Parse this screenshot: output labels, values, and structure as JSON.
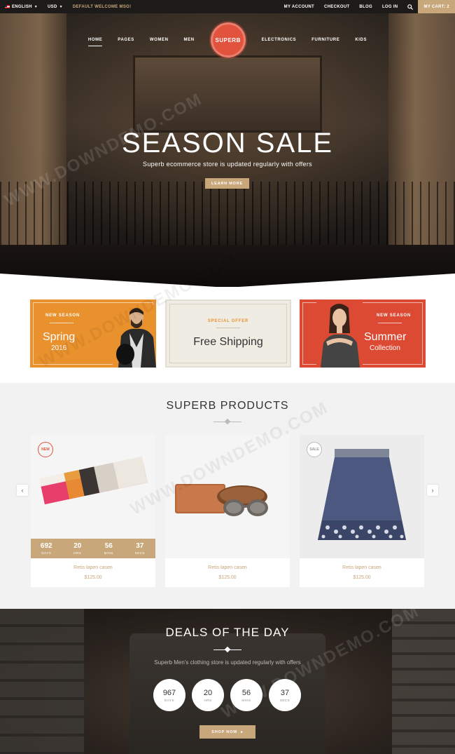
{
  "topbar": {
    "language": "ENGLISH",
    "currency": "USD",
    "welcome": "DEFAULT WELCOME MSG!",
    "links": [
      "MY ACCOUNT",
      "CHECKOUT",
      "BLOG",
      "LOG IN"
    ],
    "cart": "MY CART: 2"
  },
  "nav": {
    "left": [
      "HOME",
      "PAGES",
      "WOMEN",
      "MEN"
    ],
    "logo": "SUPERB",
    "right": [
      "ELECTRONICS",
      "FURNITURE",
      "KIDS"
    ]
  },
  "hero": {
    "title": "SEASON SALE",
    "subtitle": "Superb ecommerce store is updated regularly with offers",
    "button": "LEARN MORE"
  },
  "promos": [
    {
      "label": "NEW SEASON",
      "title": "Spring",
      "subtitle": "2016"
    },
    {
      "label": "SPECIAL OFFER",
      "title": "Free Shipping"
    },
    {
      "label": "NEW SEASON",
      "title": "Summer",
      "subtitle": "Collection"
    }
  ],
  "products": {
    "title": "SUPERB PRODUCTS",
    "items": [
      {
        "badge": "NEW",
        "name": "Retis lapen casen",
        "price": "$125.00",
        "timer": [
          {
            "n": "692",
            "u": "DAYS"
          },
          {
            "n": "20",
            "u": "HRS"
          },
          {
            "n": "56",
            "u": "MINS"
          },
          {
            "n": "37",
            "u": "SECS"
          }
        ]
      },
      {
        "name": "Retis lapen casen",
        "price": "$125.00"
      },
      {
        "badge": "SALE",
        "name": "Retis lapen casen",
        "price": "$125.00"
      }
    ]
  },
  "deals": {
    "title": "DEALS OF THE DAY",
    "subtitle": "Superb Men's clothing store is updated regularly with offers",
    "timer": [
      {
        "n": "967",
        "u": "DAYS"
      },
      {
        "n": "20",
        "u": "HRS"
      },
      {
        "n": "56",
        "u": "MINS"
      },
      {
        "n": "37",
        "u": "SECS"
      }
    ],
    "button": "SHOP NOW"
  },
  "watermark": "WWW.DOWNDEMO.COM",
  "colors": {
    "accent": "#c8a77a",
    "brand": "#e2533e",
    "orange": "#e8912d",
    "red": "#dc4a33"
  }
}
